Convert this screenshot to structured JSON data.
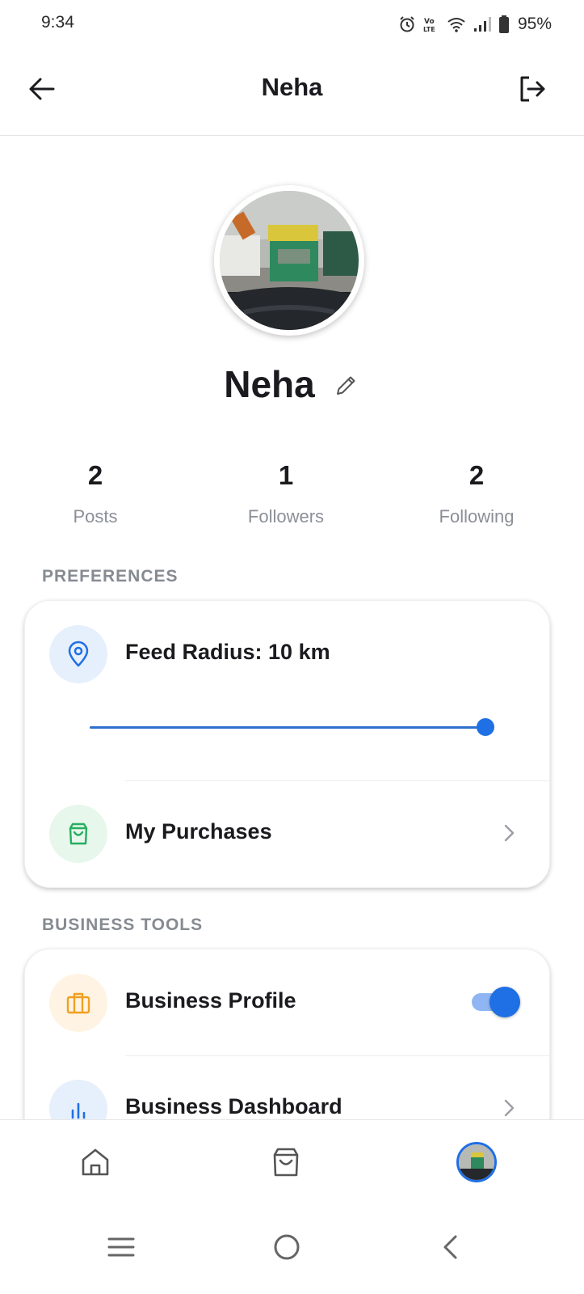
{
  "status_bar": {
    "time": "9:34",
    "battery": "95%"
  },
  "app_bar": {
    "title": "Neha"
  },
  "profile": {
    "name": "Neha"
  },
  "stats": [
    {
      "value": "2",
      "label": "Posts"
    },
    {
      "value": "1",
      "label": "Followers"
    },
    {
      "value": "2",
      "label": "Following"
    }
  ],
  "preferences": {
    "header": "PREFERENCES",
    "feed_radius_label": "Feed Radius: 10 km",
    "feed_radius_slider": 1.0,
    "my_purchases_label": "My Purchases"
  },
  "business_tools": {
    "header": "BUSINESS TOOLS",
    "business_profile_label": "Business Profile",
    "business_profile_enabled": true,
    "business_dashboard_label": "Business Dashboard"
  },
  "icons": {
    "back": "arrow-left-icon",
    "logout": "logout-icon",
    "edit": "pencil-icon",
    "location": "location-pin-icon",
    "purchases": "shopping-bag-icon",
    "business": "briefcase-icon",
    "dashboard": "bar-chart-icon",
    "home": "home-icon",
    "shop": "shopping-bag-icon"
  },
  "colors": {
    "accent": "#1f6fe5",
    "location_bg": "#e6f0fc",
    "purchases_bg": "#e7f7ec",
    "purchases_icon": "#27ae60",
    "business_bg": "#fff3e3",
    "business_icon": "#f0a020"
  }
}
